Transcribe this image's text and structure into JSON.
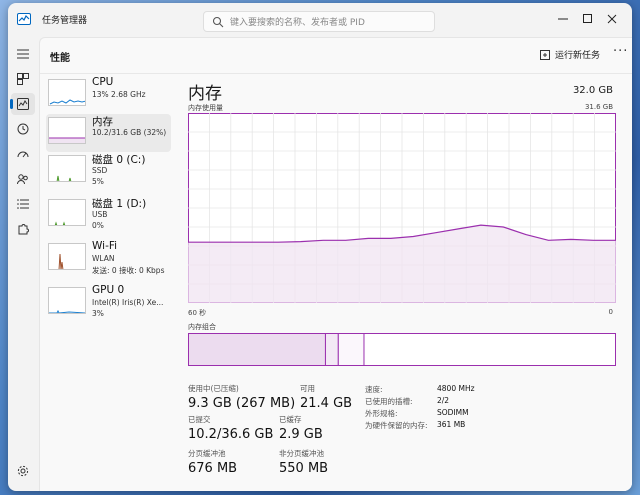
{
  "titlebar": {
    "title": "任务管理器",
    "search_placeholder": "键入要搜索的名称、发布者或 PID"
  },
  "header": {
    "page_title": "性能",
    "run_task": "运行新任务",
    "more": "···"
  },
  "resources": [
    {
      "name": "CPU",
      "lines": [
        "13% 2.68 GHz"
      ],
      "color": "#1a7fd0"
    },
    {
      "name": "内存",
      "lines": [
        "10.2/31.6 GB (32%)"
      ],
      "color": "#9b2fae"
    },
    {
      "name": "磁盘 0 (C:)",
      "lines": [
        "SSD",
        "5%"
      ],
      "color": "#4c9a2a"
    },
    {
      "name": "磁盘 1 (D:)",
      "lines": [
        "USB",
        "0%"
      ],
      "color": "#4c9a2a"
    },
    {
      "name": "Wi-Fi",
      "lines": [
        "WLAN",
        "发送: 0 接收: 0 Kbps"
      ],
      "color": "#a0522d"
    },
    {
      "name": "GPU 0",
      "lines": [
        "Intel(R) Iris(R) Xe...",
        "3%"
      ],
      "color": "#1a7fd0"
    }
  ],
  "detail": {
    "title": "内存",
    "total": "32.0 GB",
    "graph_label": "内存使用量",
    "graph_max": "31.6 GB",
    "axis_left": "60 秒",
    "axis_right": "0",
    "composition_label": "内存组合",
    "usage_fraction_series": [
      0.32,
      0.32,
      0.32,
      0.32,
      0.32,
      0.323,
      0.33,
      0.33,
      0.34,
      0.34,
      0.35,
      0.37,
      0.39,
      0.41,
      0.4,
      0.36,
      0.33,
      0.335,
      0.33,
      0.33
    ],
    "composition": {
      "in_use": 0.32,
      "modified": 0.03,
      "standby": 0.06
    }
  },
  "stats": {
    "in_use_label": "使用中(已压缩)",
    "in_use_value": "9.3 GB (267 MB)",
    "available_label": "可用",
    "available_value": "21.4 GB",
    "committed_label": "已提交",
    "committed_value": "10.2/36.6 GB",
    "cached_label": "已缓存",
    "cached_value": "2.9 GB",
    "paged_label": "分页缓冲池",
    "paged_value": "676 MB",
    "nonpaged_label": "非分页缓冲池",
    "nonpaged_value": "550 MB"
  },
  "specs": [
    {
      "k": "速度:",
      "v": "4800 MHz"
    },
    {
      "k": "已使用的插槽:",
      "v": "2/2"
    },
    {
      "k": "外形规格:",
      "v": "SODIMM"
    },
    {
      "k": "为硬件保留的内存:",
      "v": "361 MB"
    }
  ],
  "colors": {
    "memory": "#9b2fae",
    "memory_fill": "#f0e4f2",
    "accent": "#0067c0"
  }
}
